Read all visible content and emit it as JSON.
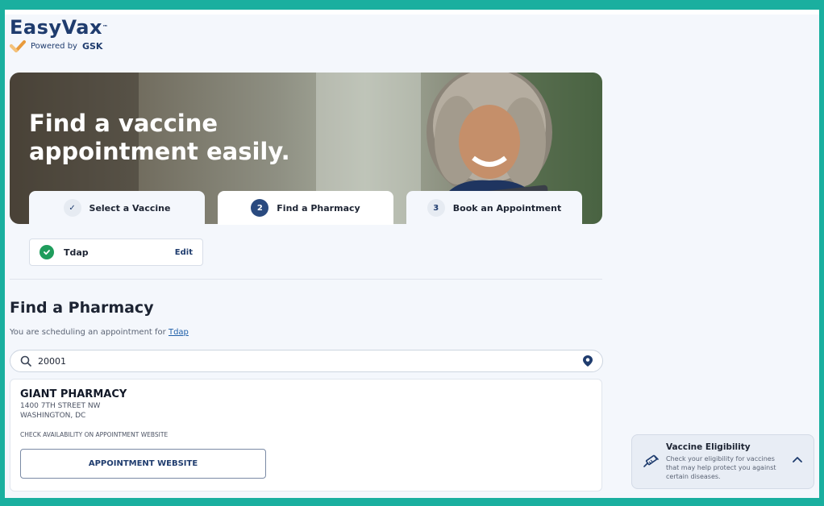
{
  "brand": {
    "name": "EasyVax",
    "trademark": "™",
    "powered_by": "Powered by",
    "company": "GSK"
  },
  "hero": {
    "title_line1": "Find a vaccine",
    "title_line2": "appointment easily."
  },
  "steps": [
    {
      "number": "✓",
      "label": "Select a Vaccine",
      "state": "done"
    },
    {
      "number": "2",
      "label": "Find a Pharmacy",
      "state": "active"
    },
    {
      "number": "3",
      "label": "Book an Appointment",
      "state": "todo"
    }
  ],
  "selected_vaccine": {
    "name": "Tdap",
    "edit_label": "Edit"
  },
  "section": {
    "title": "Find a Pharmacy",
    "schedule_prefix": "You are scheduling an appointment for",
    "schedule_vaccine": "Tdap"
  },
  "search": {
    "value": "20001"
  },
  "pharmacy": {
    "name": "GIANT PHARMACY",
    "address_line1": "1400 7TH STREET NW",
    "address_line2": "WASHINGTON, DC",
    "availability_note": "CHECK AVAILABILITY ON APPOINTMENT WEBSITE",
    "button_label": "APPOINTMENT WEBSITE"
  },
  "eligibility": {
    "title": "Vaccine Eligibility",
    "description": "Check your eligibility for vaccines that may help protect you against certain diseases."
  },
  "colors": {
    "frame": "#1aaf9f",
    "brand_navy": "#1f3c6e",
    "success_green": "#1f9d5c",
    "page_bg": "#f4f7fc"
  }
}
